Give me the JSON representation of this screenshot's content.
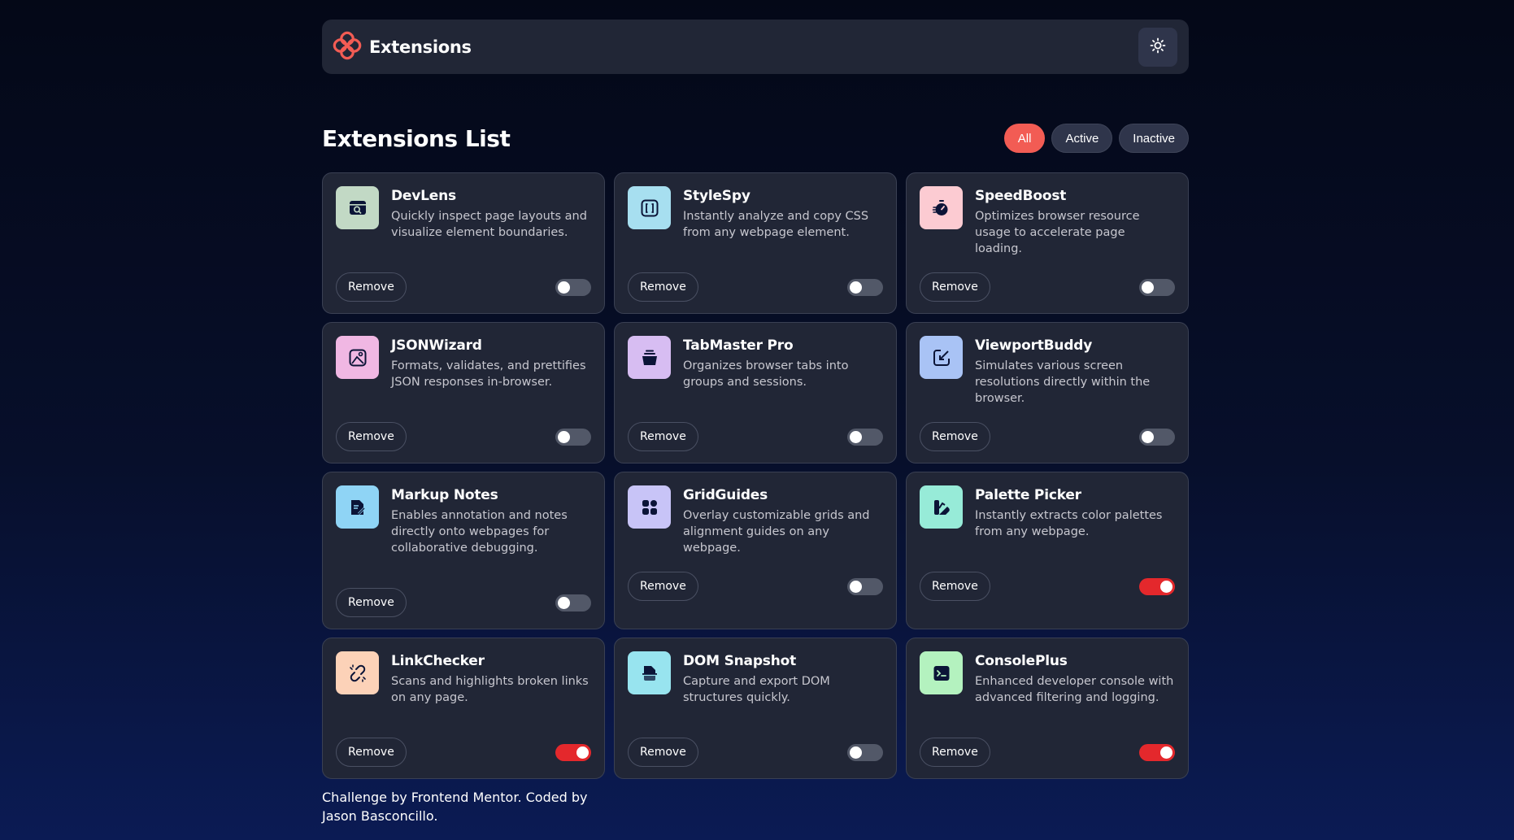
{
  "header": {
    "brand_name": "Extensions",
    "logo_icon": "extensions-logo-icon",
    "theme_icon": "sun-icon"
  },
  "list": {
    "title": "Extensions List",
    "filters": [
      {
        "label": "All",
        "active": true
      },
      {
        "label": "Active",
        "active": false
      },
      {
        "label": "Inactive",
        "active": false
      }
    ]
  },
  "extensions": [
    {
      "name": "DevLens",
      "description": "Quickly inspect page layouts and visualize element boundaries.",
      "remove_label": "Remove",
      "enabled": false,
      "icon": "devlens-icon",
      "icon_bg": "#c2d9c5"
    },
    {
      "name": "StyleSpy",
      "description": "Instantly analyze and copy CSS from any webpage element.",
      "remove_label": "Remove",
      "enabled": false,
      "icon": "stylespy-icon",
      "icon_bg": "#a7dff0"
    },
    {
      "name": "SpeedBoost",
      "description": "Optimizes browser resource usage to accelerate page loading.",
      "remove_label": "Remove",
      "enabled": false,
      "icon": "speedboost-icon",
      "icon_bg": "#fccbd2"
    },
    {
      "name": "JSONWizard",
      "description": "Formats, validates, and prettifies JSON responses in-browser.",
      "remove_label": "Remove",
      "enabled": false,
      "icon": "jsonwizard-icon",
      "icon_bg": "#f0b7e3"
    },
    {
      "name": "TabMaster Pro",
      "description": "Organizes browser tabs into groups and sessions.",
      "remove_label": "Remove",
      "enabled": false,
      "icon": "tabmaster-icon",
      "icon_bg": "#d7bdf2"
    },
    {
      "name": "ViewportBuddy",
      "description": "Simulates various screen resolutions directly within the browser.",
      "remove_label": "Remove",
      "enabled": false,
      "icon": "viewportbuddy-icon",
      "icon_bg": "#a9c3f5"
    },
    {
      "name": "Markup Notes",
      "description": "Enables annotation and notes directly onto webpages for collaborative debugging.",
      "remove_label": "Remove",
      "enabled": false,
      "icon": "markupnotes-icon",
      "icon_bg": "#8fd4f5"
    },
    {
      "name": "GridGuides",
      "description": "Overlay customizable grids and alignment guides on any webpage.",
      "remove_label": "Remove",
      "enabled": false,
      "icon": "gridguides-icon",
      "icon_bg": "#c8c4f7"
    },
    {
      "name": "Palette Picker",
      "description": "Instantly extracts color palettes from any webpage.",
      "remove_label": "Remove",
      "enabled": true,
      "icon": "palettepicker-icon",
      "icon_bg": "#97ebd8"
    },
    {
      "name": "LinkChecker",
      "description": "Scans and highlights broken links on any page.",
      "remove_label": "Remove",
      "enabled": true,
      "icon": "linkchecker-icon",
      "icon_bg": "#fcd2b8"
    },
    {
      "name": "DOM Snapshot",
      "description": "Capture and export DOM structures quickly.",
      "remove_label": "Remove",
      "enabled": false,
      "icon": "domsnapshot-icon",
      "icon_bg": "#98e4ef"
    },
    {
      "name": "ConsolePlus",
      "description": "Enhanced developer console with advanced filtering and logging.",
      "remove_label": "Remove",
      "enabled": true,
      "icon": "consoleplus-icon",
      "icon_bg": "#b4f2bf"
    }
  ],
  "footer": {
    "credit": "Challenge by Frontend Mentor. Coded by Jason Basconcillo."
  },
  "colors": {
    "accent": "#f25c54",
    "toggle_on": "#e4282c",
    "card_bg": "#212636",
    "icon_ink": "#0b1437"
  }
}
